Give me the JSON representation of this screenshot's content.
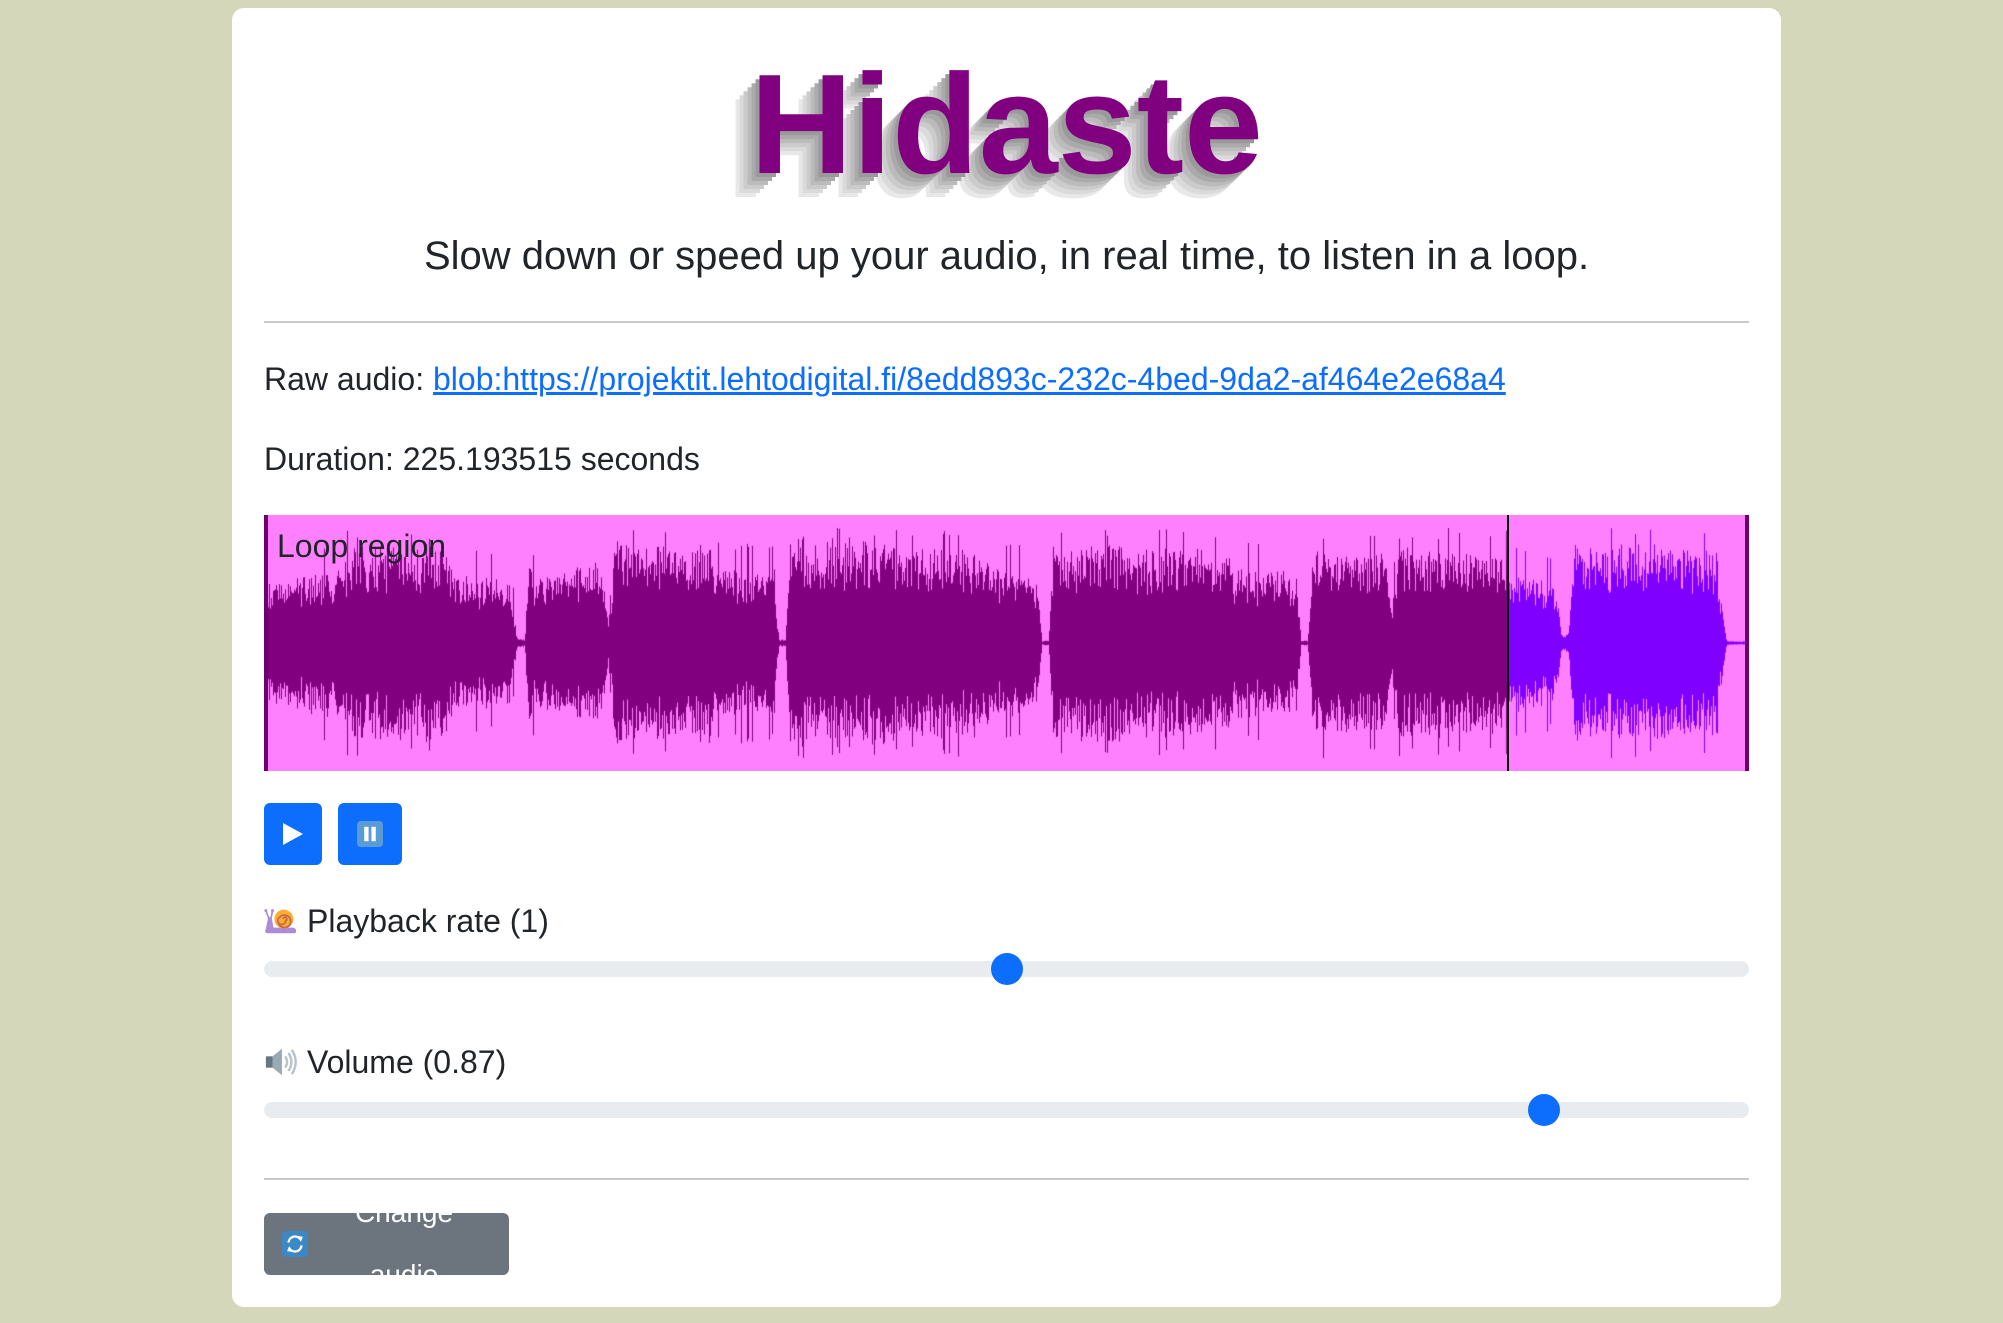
{
  "app": {
    "title": "Hidaste",
    "subtitle": "Slow down or speed up your audio, in real time, to listen in a loop."
  },
  "audio": {
    "raw_label": "Raw audio:",
    "raw_link": "blob:https://projektit.lehtodigital.fi/8edd893c-232c-4bed-9da2-af464e2e68a4",
    "duration_label": "Duration:",
    "duration_value": "225.193515 seconds"
  },
  "waveform": {
    "region_label": "Loop region",
    "progress": 0.838,
    "colors": {
      "region": "#ff80ff",
      "played": "#800080",
      "unplayed": "#8000ff",
      "cursor": "#000000",
      "handle": "#6e006e"
    }
  },
  "transport": {
    "play_icon": "play-icon",
    "pause_icon": "pause-icon"
  },
  "playback_rate": {
    "icon": "snail-icon",
    "label": "Playback rate (1)",
    "value": 1,
    "level": 0.5
  },
  "volume": {
    "icon": "speaker-icon",
    "label": "Volume (0.87)",
    "value": 0.87,
    "level": 0.87
  },
  "change_audio": {
    "icon": "refresh-icon",
    "label": "Change audio"
  },
  "colors": {
    "page_bg": "#d4d7b9",
    "card_bg": "#ffffff",
    "title": "#800080",
    "text": "#212529",
    "link": "#0d6efd",
    "primary": "#0d6efd",
    "secondary": "#6c757d",
    "slider_track": "#e9ecef",
    "slider_thumb": "#0d6efd"
  }
}
